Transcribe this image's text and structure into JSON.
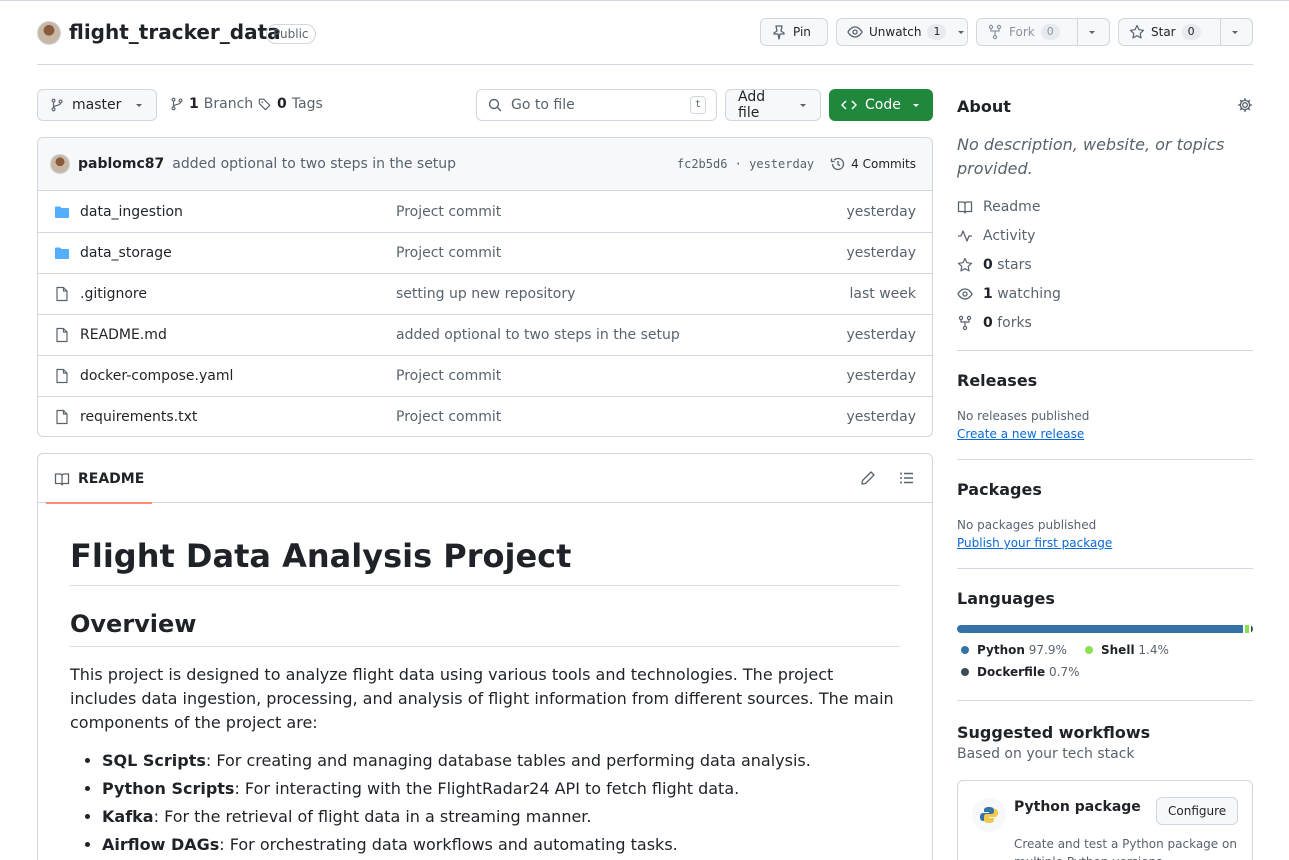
{
  "repo": {
    "name": "flight_tracker_data",
    "visibility": "Public",
    "actions": {
      "pin": "Pin",
      "unwatch": "Unwatch",
      "watch_count": "1",
      "fork": "Fork",
      "fork_count": "0",
      "star": "Star",
      "star_count": "0"
    }
  },
  "toolbar": {
    "branch": "master",
    "branches_count": "1",
    "branches_label": "Branch",
    "tags_count": "0",
    "tags_label": "Tags",
    "search_placeholder": "Go to file",
    "search_shortcut": "t",
    "add_file": "Add file",
    "code": "Code"
  },
  "commit": {
    "author": "pablomc87",
    "message": "added optional to two steps in the setup",
    "sha_time": "fc2b5d6 · yesterday",
    "commits": "4 Commits"
  },
  "files": [
    {
      "type": "folder",
      "name": "data_ingestion",
      "message": "Project commit",
      "date": "yesterday"
    },
    {
      "type": "folder",
      "name": "data_storage",
      "message": "Project commit",
      "date": "yesterday"
    },
    {
      "type": "file",
      "name": ".gitignore",
      "message": "setting up new repository",
      "date": "last week"
    },
    {
      "type": "file",
      "name": "README.md",
      "message": "added optional to two steps in the setup",
      "date": "yesterday"
    },
    {
      "type": "file",
      "name": "docker-compose.yaml",
      "message": "Project commit",
      "date": "yesterday"
    },
    {
      "type": "file",
      "name": "requirements.txt",
      "message": "Project commit",
      "date": "yesterday"
    }
  ],
  "readme": {
    "tab": "README",
    "h1": "Flight Data Analysis Project",
    "h2": "Overview",
    "intro": "This project is designed to analyze flight data using various tools and technologies. The project includes data ingestion, processing, and analysis of flight information from different sources. The main components of the project are:",
    "items": [
      {
        "term": "SQL Scripts",
        "desc": ": For creating and managing database tables and performing data analysis."
      },
      {
        "term": "Python Scripts",
        "desc": ": For interacting with the FlightRadar24 API to fetch flight data."
      },
      {
        "term": "Kafka",
        "desc": ": For the retrieval of flight data in a streaming manner."
      },
      {
        "term": "Airflow DAGs",
        "desc": ": For orchestrating data workflows and automating tasks."
      }
    ]
  },
  "sidebar": {
    "about_title": "About",
    "description": "No description, website, or topics provided.",
    "readme": "Readme",
    "activity": "Activity",
    "stars_count": "0",
    "stars_label": "stars",
    "watching_count": "1",
    "watching_label": "watching",
    "forks_count": "0",
    "forks_label": "forks",
    "releases_title": "Releases",
    "releases_none": "No releases published",
    "releases_link": "Create a new release",
    "packages_title": "Packages",
    "packages_none": "No packages published",
    "packages_link": "Publish your first package",
    "languages_title": "Languages",
    "languages": [
      {
        "name": "Python",
        "percent": "97.9%",
        "share": 97.9,
        "color": "#3572A5"
      },
      {
        "name": "Shell",
        "percent": "1.4%",
        "share": 1.4,
        "color": "#89e051"
      },
      {
        "name": "Dockerfile",
        "percent": "0.7%",
        "share": 0.7,
        "color": "#384d54"
      }
    ],
    "workflows_title": "Suggested workflows",
    "workflows_sub": "Based on your tech stack",
    "workflow_name": "Python package",
    "workflow_button": "Configure",
    "workflow_desc": "Create and test a Python package on multiple Python versions."
  },
  "colors": {
    "accent": "#1f883d",
    "link": "#0969da",
    "folder": "#54aeff"
  }
}
